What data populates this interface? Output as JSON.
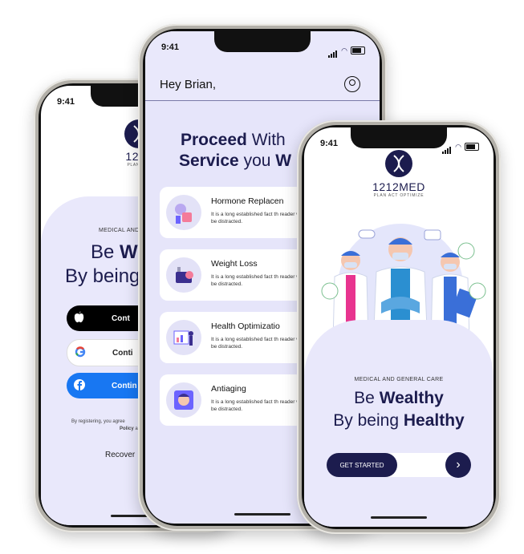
{
  "status": {
    "time": "9:41"
  },
  "screen_login": {
    "brand": "1212",
    "tagline": "PLAN ACT",
    "kicker": "MEDICAL AND",
    "headline_1_pre": "Be ",
    "headline_1_bold": "W",
    "headline_2": "By being",
    "apple_label": "Cont",
    "google_label": "Conti",
    "facebook_label": "Contin",
    "terms_1": "By registering, you agree",
    "terms_2_bold": "Policy",
    "terms_2_rest": " and",
    "recover_label": "Recover",
    "colors": {
      "apple": "#000000",
      "google_bg": "#ffffff",
      "facebook": "#1877f2"
    }
  },
  "screen_services": {
    "greeting": "Hey Brian,",
    "title_1_bold": "Proceed",
    "title_1_rest": " With",
    "title_2_bold": "Service",
    "title_2_rest": " you ",
    "title_2_end": "W",
    "services": [
      {
        "title": "Hormone Replacen",
        "desc": "It is a long established fact th reader will be distracted."
      },
      {
        "title": "Weight Loss",
        "desc": "It is a long established fact th reader will be distracted."
      },
      {
        "title": "Health Optimizatio",
        "desc": "It is a long established fact th reader will be distracted."
      },
      {
        "title": "Antiaging",
        "desc": "It is a long established fact th reader will be distracted."
      }
    ]
  },
  "screen_welcome": {
    "brand": "1212MED",
    "tagline": "PLAN ACT OPTIMIZE",
    "kicker": "MEDICAL AND GENERAL CARE",
    "headline_1_pre": "Be ",
    "headline_1_bold": "Wealthy",
    "headline_2_pre": "By being ",
    "headline_2_bold": "Healthy",
    "cta_label": "GET STARTED",
    "cta_arrow": "›"
  }
}
